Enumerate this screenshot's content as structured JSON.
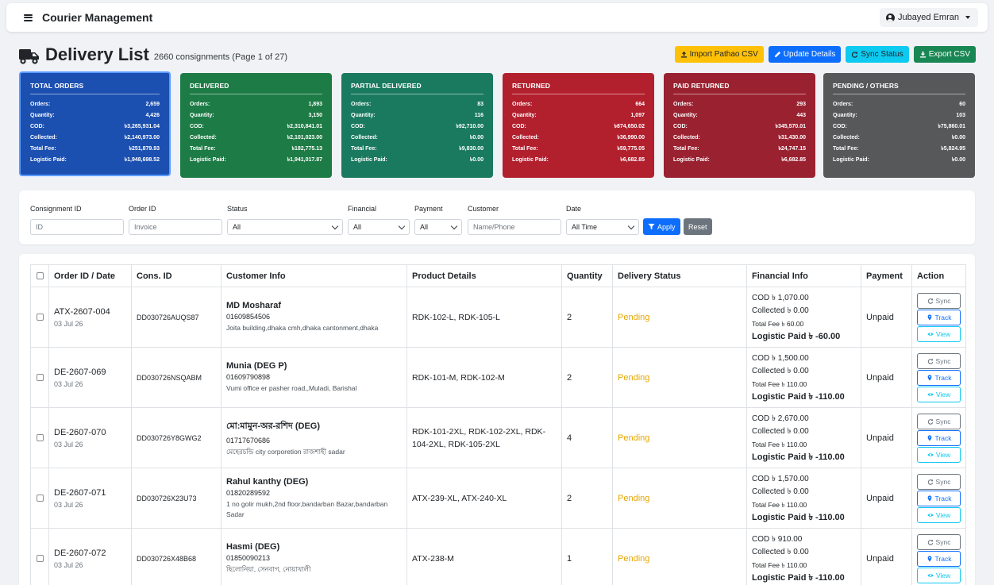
{
  "navbar": {
    "brand": "Courier Management",
    "user": "Jubayed Emran"
  },
  "page": {
    "title": "Delivery List",
    "subtitle": "2660 consignments (Page 1 of 27)"
  },
  "actions": {
    "import": "Import Pathao CSV",
    "update": "Update Details",
    "sync": "Sync Status",
    "export": "Export CSV"
  },
  "cards": [
    {
      "title": "TOTAL ORDERS",
      "rows": [
        [
          "Orders:",
          "2,659"
        ],
        [
          "Quantity:",
          "4,426"
        ],
        [
          "COD:",
          "৳3,265,931.04"
        ],
        [
          "Collected:",
          "৳2,140,973.00"
        ],
        [
          "Total Fee:",
          "৳251,879.93"
        ],
        [
          "Logistic Paid:",
          "৳1,948,698.52"
        ]
      ]
    },
    {
      "title": "DELIVERED",
      "rows": [
        [
          "Orders:",
          "1,893"
        ],
        [
          "Quantity:",
          "3,150"
        ],
        [
          "COD:",
          "৳2,310,841.01"
        ],
        [
          "Collected:",
          "৳2,101,023.00"
        ],
        [
          "Total Fee:",
          "৳182,775.13"
        ],
        [
          "Logistic Paid:",
          "৳1,941,017.87"
        ]
      ]
    },
    {
      "title": "PARTIAL DELIVERED",
      "rows": [
        [
          "Orders:",
          "83"
        ],
        [
          "Quantity:",
          "116"
        ],
        [
          "COD:",
          "৳92,710.00"
        ],
        [
          "Collected:",
          "৳0.00"
        ],
        [
          "Total Fee:",
          "৳9,830.00"
        ],
        [
          "Logistic Paid:",
          "৳0.00"
        ]
      ]
    },
    {
      "title": "RETURNED",
      "rows": [
        [
          "Orders:",
          "664"
        ],
        [
          "Quantity:",
          "1,097"
        ],
        [
          "COD:",
          "৳874,650.02"
        ],
        [
          "Collected:",
          "৳36,990.00"
        ],
        [
          "Total Fee:",
          "৳59,775.05"
        ],
        [
          "Logistic Paid:",
          "৳6,682.85"
        ]
      ]
    },
    {
      "title": "PAID RETURNED",
      "rows": [
        [
          "Orders:",
          "293"
        ],
        [
          "Quantity:",
          "443"
        ],
        [
          "COD:",
          "৳345,570.01"
        ],
        [
          "Collected:",
          "৳31,430.00"
        ],
        [
          "Total Fee:",
          "৳24,747.15"
        ],
        [
          "Logistic Paid:",
          "৳6,682.85"
        ]
      ]
    },
    {
      "title": "PENDING / OTHERS",
      "rows": [
        [
          "Orders:",
          "60"
        ],
        [
          "Quantity:",
          "103"
        ],
        [
          "COD:",
          "৳75,860.01"
        ],
        [
          "Collected:",
          "৳0.00"
        ],
        [
          "Total Fee:",
          "৳5,824.95"
        ],
        [
          "Logistic Paid:",
          "৳0.00"
        ]
      ]
    }
  ],
  "filters": {
    "consignment_label": "Consignment ID",
    "consignment_placeholder": "ID",
    "order_label": "Order ID",
    "order_placeholder": "Invoice",
    "status_label": "Status",
    "status_value": "All",
    "financial_label": "Financial",
    "financial_value": "All",
    "payment_label": "Payment",
    "payment_value": "All",
    "customer_label": "Customer",
    "customer_placeholder": "Name/Phone",
    "date_label": "Date",
    "date_value": "All Time",
    "apply": "Apply",
    "reset": "Reset"
  },
  "table": {
    "headers": [
      "Order ID / Date",
      "Cons. ID",
      "Customer Info",
      "Product Details",
      "Quantity",
      "Delivery Status",
      "Financial Info",
      "Payment",
      "Action"
    ],
    "action_labels": {
      "sync": "Sync",
      "track": "Track",
      "view": "View"
    },
    "rows": [
      {
        "order_id": "ATX-2607-004",
        "date": "03 Jul 26",
        "cons_id": "DD030726AUQS87",
        "name": "MD Mosharaf",
        "phone": "01609854506",
        "address": "Joita building,dhaka cmh,dhaka cantonment,dhaka",
        "products": "RDK-102-L, RDK-105-L",
        "qty": "2",
        "status": "Pending",
        "cod": "COD ৳ 1,070.00",
        "collected": "Collected ৳ 0.00",
        "fee": "Total Fee ৳ 60.00",
        "logistic": "Logistic Paid ৳ -60.00",
        "payment": "Unpaid"
      },
      {
        "order_id": "DE-2607-069",
        "date": "03 Jul 26",
        "cons_id": "DD030726NSQABM",
        "name": "Munia (DEG P)",
        "phone": "01609790898",
        "address": "Vumi office er pasher road,,Muladi, Barishal",
        "products": "RDK-101-M, RDK-102-M",
        "qty": "2",
        "status": "Pending",
        "cod": "COD ৳ 1,500.00",
        "collected": "Collected ৳ 0.00",
        "fee": "Total Fee ৳ 110.00",
        "logistic": "Logistic Paid ৳ -110.00",
        "payment": "Unpaid"
      },
      {
        "order_id": "DE-2607-070",
        "date": "03 Jul 26",
        "cons_id": "DD030726Y8GWG2",
        "name": "মো:মামুন-অর-রশিদ (DEG)",
        "phone": "01717670686",
        "address": "মেহেরচন্ডি city corporetion রাজশাহী sadar",
        "products": "RDK-101-2XL, RDK-102-2XL, RDK-104-2XL, RDK-105-2XL",
        "qty": "4",
        "status": "Pending",
        "cod": "COD ৳ 2,670.00",
        "collected": "Collected ৳ 0.00",
        "fee": "Total Fee ৳ 110.00",
        "logistic": "Logistic Paid ৳ -110.00",
        "payment": "Unpaid"
      },
      {
        "order_id": "DE-2607-071",
        "date": "03 Jul 26",
        "cons_id": "DD030726X23U73",
        "name": "Rahul kanthy (DEG)",
        "phone": "01820289592",
        "address": "1 no golir mukh,2nd floor,bandarban Bazar,bandarban Sadar",
        "products": "ATX-239-XL, ATX-240-XL",
        "qty": "2",
        "status": "Pending",
        "cod": "COD ৳ 1,570.00",
        "collected": "Collected ৳ 0.00",
        "fee": "Total Fee ৳ 110.00",
        "logistic": "Logistic Paid ৳ -110.00",
        "payment": "Unpaid"
      },
      {
        "order_id": "DE-2607-072",
        "date": "03 Jul 26",
        "cons_id": "DD030726X48B68",
        "name": "Hasmi (DEG)",
        "phone": "01850090213",
        "address": "ছিলোনিয়া, সেনবাগ, নোয়াখালী",
        "products": "ATX-238-M",
        "qty": "1",
        "status": "Pending",
        "cod": "COD ৳ 910.00",
        "collected": "Collected ৳ 0.00",
        "fee": "Total Fee ৳ 110.00",
        "logistic": "Logistic Paid ৳ -110.00",
        "payment": "Unpaid"
      }
    ]
  },
  "colors": {
    "total": "#1b4fb0",
    "delivered": "#1d7b45",
    "partial": "#1a7a60",
    "returned": "#b21f2d",
    "paid_returned": "#9a2130",
    "pending": "#565859",
    "status_pending": "#e7a700"
  },
  "icons": [
    "menu-icon",
    "user-circle-icon",
    "truck-icon",
    "upload-icon",
    "pencil-icon",
    "refresh-icon",
    "download-icon",
    "filter-icon",
    "map-pin-icon",
    "eye-icon"
  ]
}
